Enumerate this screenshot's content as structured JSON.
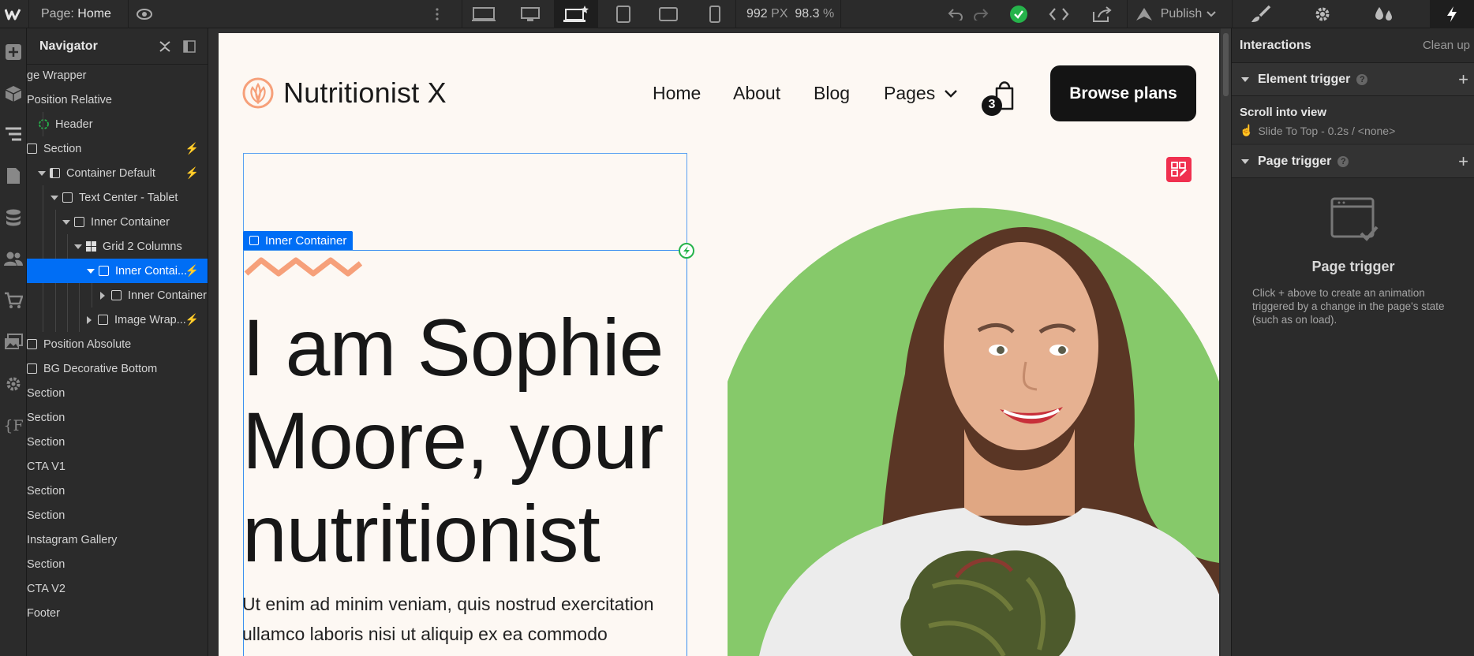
{
  "topbar": {
    "page_label": "Page:",
    "page_name": "Home",
    "width_value": "992",
    "width_unit": "PX",
    "zoom_value": "98.3",
    "zoom_unit": "%",
    "publish_label": "Publish"
  },
  "navigator": {
    "title": "Navigator",
    "items": [
      {
        "label": "ge Wrapper"
      },
      {
        "label": "Position Relative"
      },
      {
        "label": "Header"
      },
      {
        "label": "Section"
      },
      {
        "label": "Container Default"
      },
      {
        "label": "Text Center - Tablet"
      },
      {
        "label": "Inner Container"
      },
      {
        "label": "Grid 2 Columns"
      },
      {
        "label": "Inner Contai..."
      },
      {
        "label": "Inner Container"
      },
      {
        "label": "Image Wrap..."
      },
      {
        "label": "Position Absolute"
      },
      {
        "label": "BG Decorative Bottom"
      },
      {
        "label": "Section"
      },
      {
        "label": "Section"
      },
      {
        "label": "Section"
      },
      {
        "label": "CTA V1"
      },
      {
        "label": "Section"
      },
      {
        "label": "Section"
      },
      {
        "label": "Instagram Gallery"
      },
      {
        "label": "Section"
      },
      {
        "label": "CTA V2"
      },
      {
        "label": "Footer"
      }
    ]
  },
  "site": {
    "brand": "Nutritionist X",
    "nav": [
      "Home",
      "About",
      "Blog",
      "Pages"
    ],
    "cart_count": "3",
    "cta": "Browse plans",
    "selected_tag": "Inner Container",
    "hero_title": "I am Sophie Moore, your nutritionist",
    "paragraph": "Ut enim ad minim veniam, quis nostrud exercitation ullamco laboris nisi ut aliquip ex ea commodo"
  },
  "interactions": {
    "title": "Interactions",
    "clean_up": "Clean up",
    "element_trigger": "Element trigger",
    "trigger_name": "Scroll into view",
    "trigger_detail": "Slide To Top - 0.2s / <none>",
    "page_trigger": "Page trigger",
    "empty_title": "Page trigger",
    "empty_text": "Click + above to create an animation triggered by a change in the page's state (such as on load)."
  },
  "colors": {
    "accent": "#006ef5",
    "brand_orange": "#f6a07a",
    "hero_green": "#86c96a",
    "success": "#26b34b",
    "badge_red": "#f0304f"
  }
}
